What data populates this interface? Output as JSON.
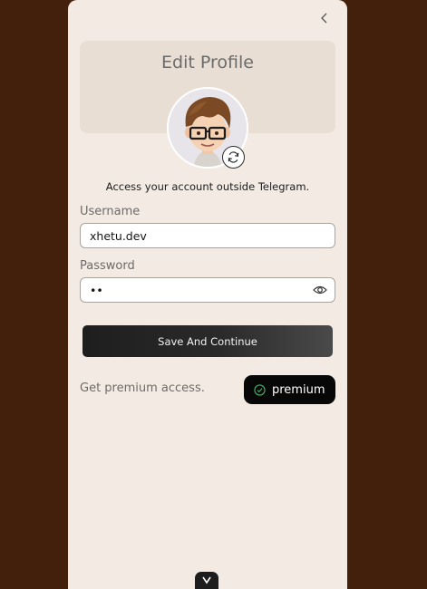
{
  "header": {
    "title": "Edit Profile"
  },
  "info_text": "Access your account outside Telegram.",
  "username": {
    "label": "Username",
    "value": "xhetu.dev"
  },
  "password": {
    "label": "Password",
    "value": "••"
  },
  "actions": {
    "save_label": "Save And Continue"
  },
  "premium": {
    "prompt": "Get premium access.",
    "button_label": "premium"
  },
  "colors": {
    "background": "#42200c",
    "card": "#f3ebe3",
    "header_panel": "#e8ded4",
    "accent_check": "#3dbb5d"
  }
}
